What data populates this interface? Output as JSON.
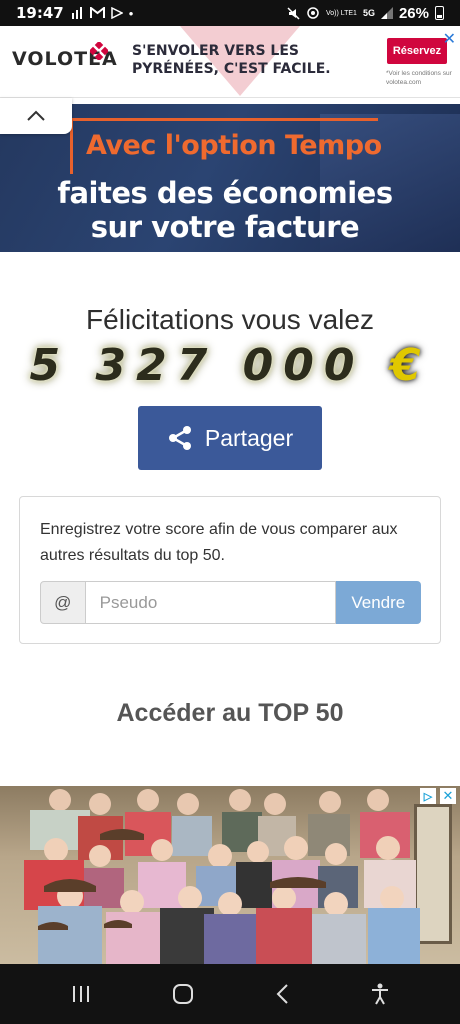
{
  "status_bar": {
    "time": "19:47",
    "battery": "26%",
    "network": "5G",
    "volte": "Vo)) LTE1"
  },
  "ad_top": {
    "brand": "VOLOTEA",
    "slogan": "S'ENVOLER VERS LES PYRÉNÉES, C'EST FACILE.",
    "button": "Réservez",
    "note": "*Voir les conditions sur volotea.com",
    "accent_color": "#d0063e"
  },
  "banner": {
    "line1": "Avec l'option Tempo",
    "line2a": "faites des économies",
    "line2b": "sur votre facture",
    "accent_color": "#ef6a2f"
  },
  "result": {
    "congrats": "Félicitations vous valez",
    "amount": "5 327 000",
    "currency": "€"
  },
  "share": {
    "label": "Partager",
    "color": "#3b5999"
  },
  "score_form": {
    "text": "Enregistrez votre score afin de vous comparer aux autres résultats du top 50.",
    "addon": "@",
    "placeholder": "Pseudo",
    "submit": "Vendre",
    "submit_color": "#7ca9d6"
  },
  "top50_link": "Accéder au TOP 50",
  "ad_bottom": {
    "icons": [
      "adchoices-icon",
      "close-icon"
    ]
  },
  "nav": {
    "icons": [
      "recents-icon",
      "home-icon",
      "back-icon",
      "accessibility-icon"
    ]
  }
}
